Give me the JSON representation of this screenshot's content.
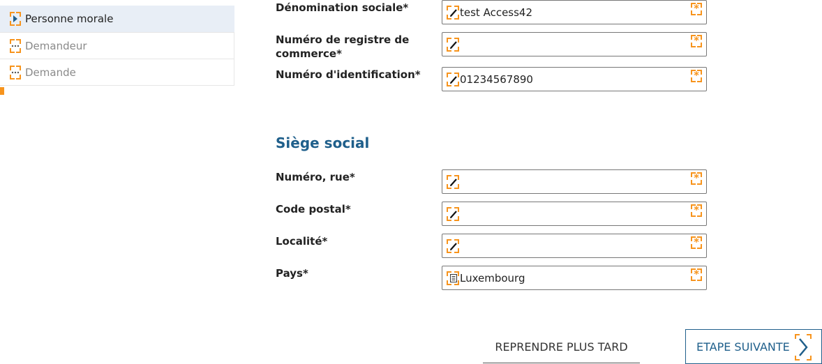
{
  "sidebar": {
    "items": [
      {
        "label": "Personne morale",
        "state": "active",
        "icon": "play-frame-icon"
      },
      {
        "label": "Demandeur",
        "state": "inactive",
        "icon": "dots-frame-icon"
      },
      {
        "label": "Demande",
        "state": "inactive",
        "icon": "dots-frame-icon"
      }
    ]
  },
  "form": {
    "denomination": {
      "label": "Dénomination sociale*",
      "value": "test Access42"
    },
    "rcs": {
      "label": "Numéro de registre de commerce*",
      "value": ""
    },
    "identification": {
      "label": "Numéro d'identification*",
      "value": "01234567890"
    },
    "section_title": "Siège social",
    "street": {
      "label": "Numéro, rue*",
      "value": ""
    },
    "postal": {
      "label": "Code postal*",
      "value": ""
    },
    "locality": {
      "label": "Localité*",
      "value": ""
    },
    "country": {
      "label": "Pays*",
      "value": "Luxembourg"
    }
  },
  "actions": {
    "later_label": "REPRENDRE PLUS TARD",
    "next_label": "ETAPE SUIVANTE"
  },
  "colors": {
    "accent": "#f7941d",
    "primary": "#1f5f8b",
    "active_bg": "#e8eef6"
  }
}
